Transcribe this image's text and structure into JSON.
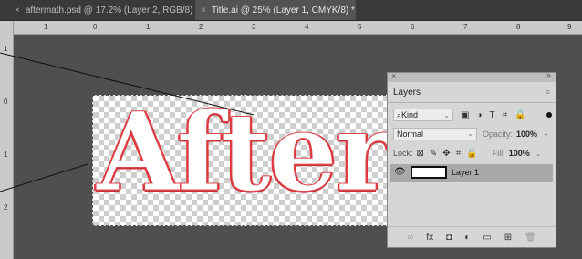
{
  "tabs": [
    {
      "close": "×",
      "label": "aftermath.psd @ 17.2% (Layer 2, RGB/8)"
    },
    {
      "close": "×",
      "label": "Title.ai @ 25% (Layer 1, CMYK/8) *"
    }
  ],
  "ruler_top_numbers": [
    "1",
    "0",
    "1",
    "2",
    "3",
    "4",
    "5",
    "6",
    "7",
    "8",
    "9"
  ],
  "ruler_left_numbers": [
    "1",
    "0",
    "1",
    "2"
  ],
  "artboard": {
    "text": "Afterma"
  },
  "layers_panel": {
    "close_glyph": "×",
    "collapse_glyph": "»",
    "tab": "Layers",
    "menu_glyph": "≡",
    "filter_kind": "Kind",
    "blend_mode": "Normal",
    "opacity_label": "Opacity:",
    "opacity_value": "100%",
    "lock_label": "Lock:",
    "fill_label": "Fill:",
    "fill_value": "100%",
    "layer_name": "Layer 1"
  },
  "icons": {
    "search": "⌕",
    "pixel": "▣",
    "adjustment": "◑",
    "type": "T",
    "shape": "⌗",
    "smart": "🔒",
    "chevron": "⌄",
    "eye": "👁",
    "lock_pixels": "⊠",
    "lock_paint": "✎",
    "lock_position": "✥",
    "lock_artboard": "⌗",
    "lock_all": "🔒",
    "link": "∞",
    "fx": "fx",
    "mask": "◘",
    "adjust": "◐",
    "folder": "▭",
    "new": "⊞",
    "trash": "🗑"
  }
}
